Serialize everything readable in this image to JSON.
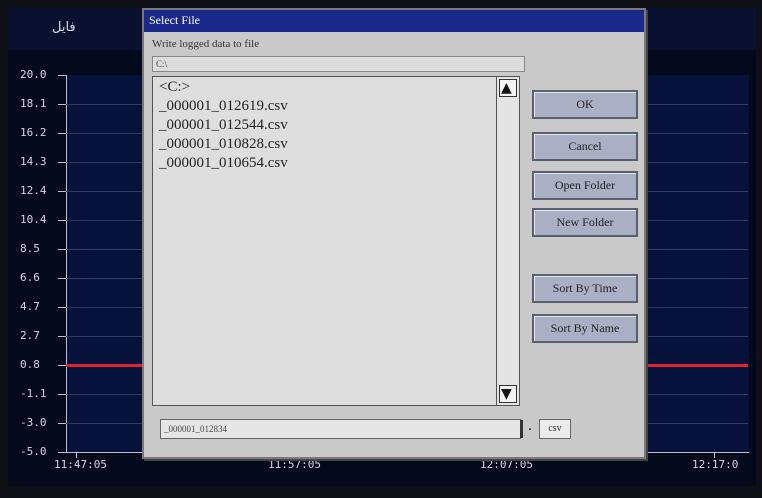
{
  "app": {
    "title": "فایل"
  },
  "chart_data": {
    "type": "line",
    "title": "",
    "y_ticks": [
      "20.0",
      "18.1",
      "16.2",
      "14.3",
      "12.4",
      "10.4",
      "8.5",
      "6.6",
      "4.7",
      "2.7",
      "0.8",
      "-1.1",
      "-3.0",
      "-5.0"
    ],
    "x_ticks": [
      "11:47:05",
      "11:57:05",
      "12:07:05",
      "12:17:0"
    ],
    "ylim": [
      -5.0,
      20.0
    ],
    "series": [
      {
        "color": "#e0242c",
        "values": [
          0.8,
          0.8,
          0.8,
          0.8
        ]
      }
    ],
    "grid": true
  },
  "dialog": {
    "title": "Select File",
    "subtitle": "Write logged data to file",
    "path": "C:\\",
    "files": [
      "<C:>",
      "_000001_012619.csv",
      "_000001_012544.csv",
      "_000001_010828.csv",
      "_000001_010654.csv"
    ],
    "buttons": {
      "ok": "OK",
      "cancel": "Cancel",
      "open_folder": "Open Folder",
      "new_folder": "New Folder",
      "sort_time": "Sort By Time",
      "sort_name": "Sort By Name"
    },
    "filename_value": "_000001_012834",
    "extension": "csv",
    "scroll_up_icon": "triangle-up-icon",
    "scroll_down_icon": "triangle-down-icon"
  }
}
